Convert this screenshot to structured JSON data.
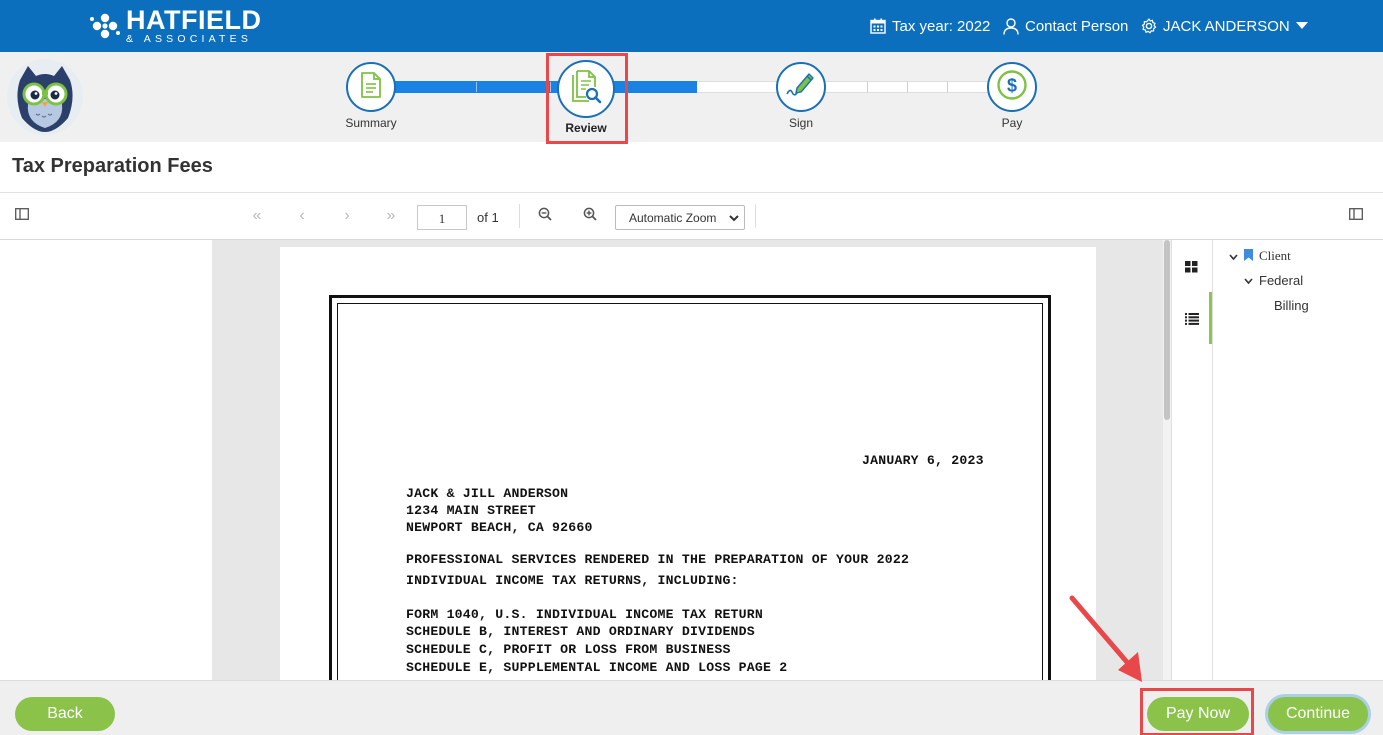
{
  "brand": {
    "name": "HATFIELD",
    "sub": "& ASSOCIATES"
  },
  "header": {
    "tax_year": "Tax year: 2022",
    "contact": "Contact Person",
    "user": "JACK ANDERSON",
    "icons": [
      "calendar-icon",
      "person-icon",
      "gear-icon",
      "caret-down-icon"
    ]
  },
  "steps": [
    {
      "label": "Summary",
      "icon": "document-icon"
    },
    {
      "label": "Review",
      "icon": "document-search-icon",
      "active": true
    },
    {
      "label": "Sign",
      "icon": "pen-icon"
    },
    {
      "label": "Pay",
      "icon": "dollar-icon"
    }
  ],
  "page_title": "Tax Preparation Fees",
  "pdf_toolbar": {
    "page_value": "1",
    "page_count": "of 1",
    "zoom": "Automatic Zoom"
  },
  "outline": {
    "items": [
      {
        "label": "Client"
      },
      {
        "label": "Federal"
      },
      {
        "label": "Billing"
      }
    ]
  },
  "document": {
    "date": "JANUARY 6, 2023",
    "address": [
      "JACK & JILL ANDERSON",
      "1234 MAIN STREET",
      "NEWPORT BEACH, CA 92660"
    ],
    "services": [
      "PROFESSIONAL SERVICES RENDERED IN THE PREPARATION OF YOUR 2022",
      "INDIVIDUAL INCOME TAX RETURNS, INCLUDING:"
    ],
    "forms": [
      "FORM 1040, U.S. INDIVIDUAL INCOME TAX RETURN",
      "SCHEDULE B, INTEREST AND ORDINARY DIVIDENDS",
      "SCHEDULE C, PROFIT OR LOSS FROM BUSINESS",
      "SCHEDULE E, SUPPLEMENTAL INCOME AND LOSS PAGE 2"
    ]
  },
  "footer": {
    "back": "Back",
    "pay_now": "Pay Now",
    "continue": "Continue"
  },
  "colors": {
    "header_blue": "#0b6fbe",
    "progress_blue": "#1a82e2",
    "button_green": "#8bc34a",
    "highlight_red": "#e8484a"
  }
}
